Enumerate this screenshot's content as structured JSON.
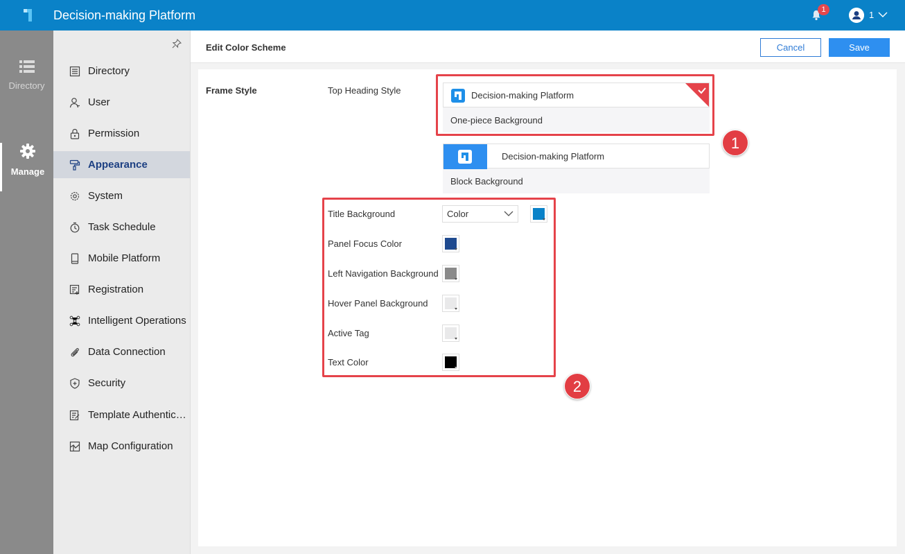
{
  "app": {
    "title": "Decision-making Platform"
  },
  "header": {
    "notification_count": "1",
    "user_name": "1"
  },
  "rail": {
    "items": [
      {
        "label": "Directory",
        "icon": "list-icon"
      },
      {
        "label": "Manage",
        "icon": "gear-icon",
        "active": true
      }
    ]
  },
  "nav": {
    "items": [
      {
        "label": "Directory",
        "icon": "directory-icon"
      },
      {
        "label": "User",
        "icon": "user-icon"
      },
      {
        "label": "Permission",
        "icon": "lock-icon"
      },
      {
        "label": "Appearance",
        "icon": "paint-roller-icon",
        "active": true
      },
      {
        "label": "System",
        "icon": "gear-icon"
      },
      {
        "label": "Task Schedule",
        "icon": "timer-icon"
      },
      {
        "label": "Mobile Platform",
        "icon": "mobile-icon"
      },
      {
        "label": "Registration",
        "icon": "registration-icon"
      },
      {
        "label": "Intelligent Operations",
        "icon": "network-icon"
      },
      {
        "label": "Data Connection",
        "icon": "paperclip-icon"
      },
      {
        "label": "Security",
        "icon": "shield-icon"
      },
      {
        "label": "Template Authentic…",
        "icon": "document-edit-icon"
      },
      {
        "label": "Map Configuration",
        "icon": "map-icon"
      }
    ]
  },
  "main": {
    "title": "Edit Color Scheme",
    "cancel_label": "Cancel",
    "save_label": "Save",
    "frame_style_label": "Frame Style",
    "top_heading_style_label": "Top Heading Style",
    "styles": [
      {
        "header_text": "Decision-making Platform",
        "caption": "One-piece Background",
        "selected": true
      },
      {
        "header_text": "Decision-making Platform",
        "caption": "Block Background",
        "selected": false
      }
    ],
    "colors": [
      {
        "label": "Title Background",
        "select_value": "Color",
        "color": "#0a82c8"
      },
      {
        "label": "Panel Focus Color",
        "color": "#1f4a8f"
      },
      {
        "label": "Left Navigation Background",
        "color": "#8a8a8a"
      },
      {
        "label": "Hover Panel Background",
        "color": "#e9e9ea"
      },
      {
        "label": "Active Tag",
        "color": "#e9e9ea"
      },
      {
        "label": "Text Color",
        "color": "#000000"
      }
    ]
  },
  "annotations": {
    "first": "1",
    "second": "2"
  },
  "theme": {
    "brand": "#0a82c8",
    "accent": "#2e8ff0",
    "annotation": "#e23d43"
  }
}
